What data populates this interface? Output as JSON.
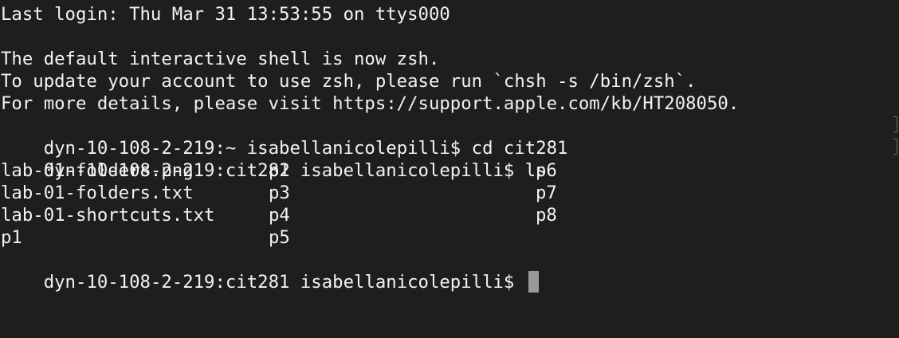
{
  "terminal": {
    "last_login": "Last login: Thu Mar 31 13:53:55 on ttys000",
    "blank": "",
    "msg1": "The default interactive shell is now zsh.",
    "msg2": "To update your account to use zsh, please run `chsh -s /bin/zsh`.",
    "msg3": "For more details, please visit https://support.apple.com/kb/HT208050.",
    "cmd1": "dyn-10-108-2-219:~ isabellanicolepilli$ cd cit281",
    "cmd2": "dyn-10-108-2-219:cit281 isabellanicolepilli$ ls",
    "prompt": "dyn-10-108-2-219:cit281 isabellanicolepilli$ "
  },
  "ls_output": [
    [
      "lab-01-folders.png",
      "p2",
      "p6"
    ],
    [
      "lab-01-folders.txt",
      "p3",
      "p7"
    ],
    [
      "lab-01-shortcuts.txt",
      "p4",
      "p8"
    ],
    [
      "p1",
      "p5",
      ""
    ]
  ],
  "colors": {
    "background": "#1e1e1e",
    "text": "#f2f2f2",
    "cursor": "#9a9a9a"
  }
}
